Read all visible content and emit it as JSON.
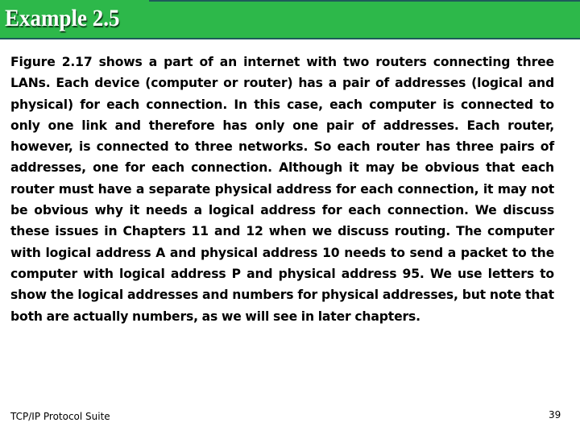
{
  "header": {
    "title": "Example 2.5",
    "colors": {
      "band": "#2db84a",
      "border": "#1f5a5a",
      "title": "#ffffff"
    }
  },
  "body": {
    "paragraph": "Figure 2.17 shows a part of an internet with two routers connecting three LANs. Each device (computer or router) has a pair of addresses (logical and physical) for each connection. In this case, each computer is connected to only one link and therefore has only one pair of addresses. Each router, however, is connected to three networks. So each router has three pairs of addresses, one for each connection. Although it may be obvious that each router must have a separate physical address for each connection, it may not be obvious why it needs a logical address for each connection. We discuss these issues in Chapters 11 and 12 when we discuss routing. The computer with logical address A and physical address 10 needs to send a packet to the computer with logical address P and physical address 95. We use letters to show the logical addresses and numbers for physical addresses, but note that both are actually numbers, as we will see in later chapters."
  },
  "footer": {
    "source": "TCP/IP Protocol Suite",
    "page_number": "39"
  }
}
